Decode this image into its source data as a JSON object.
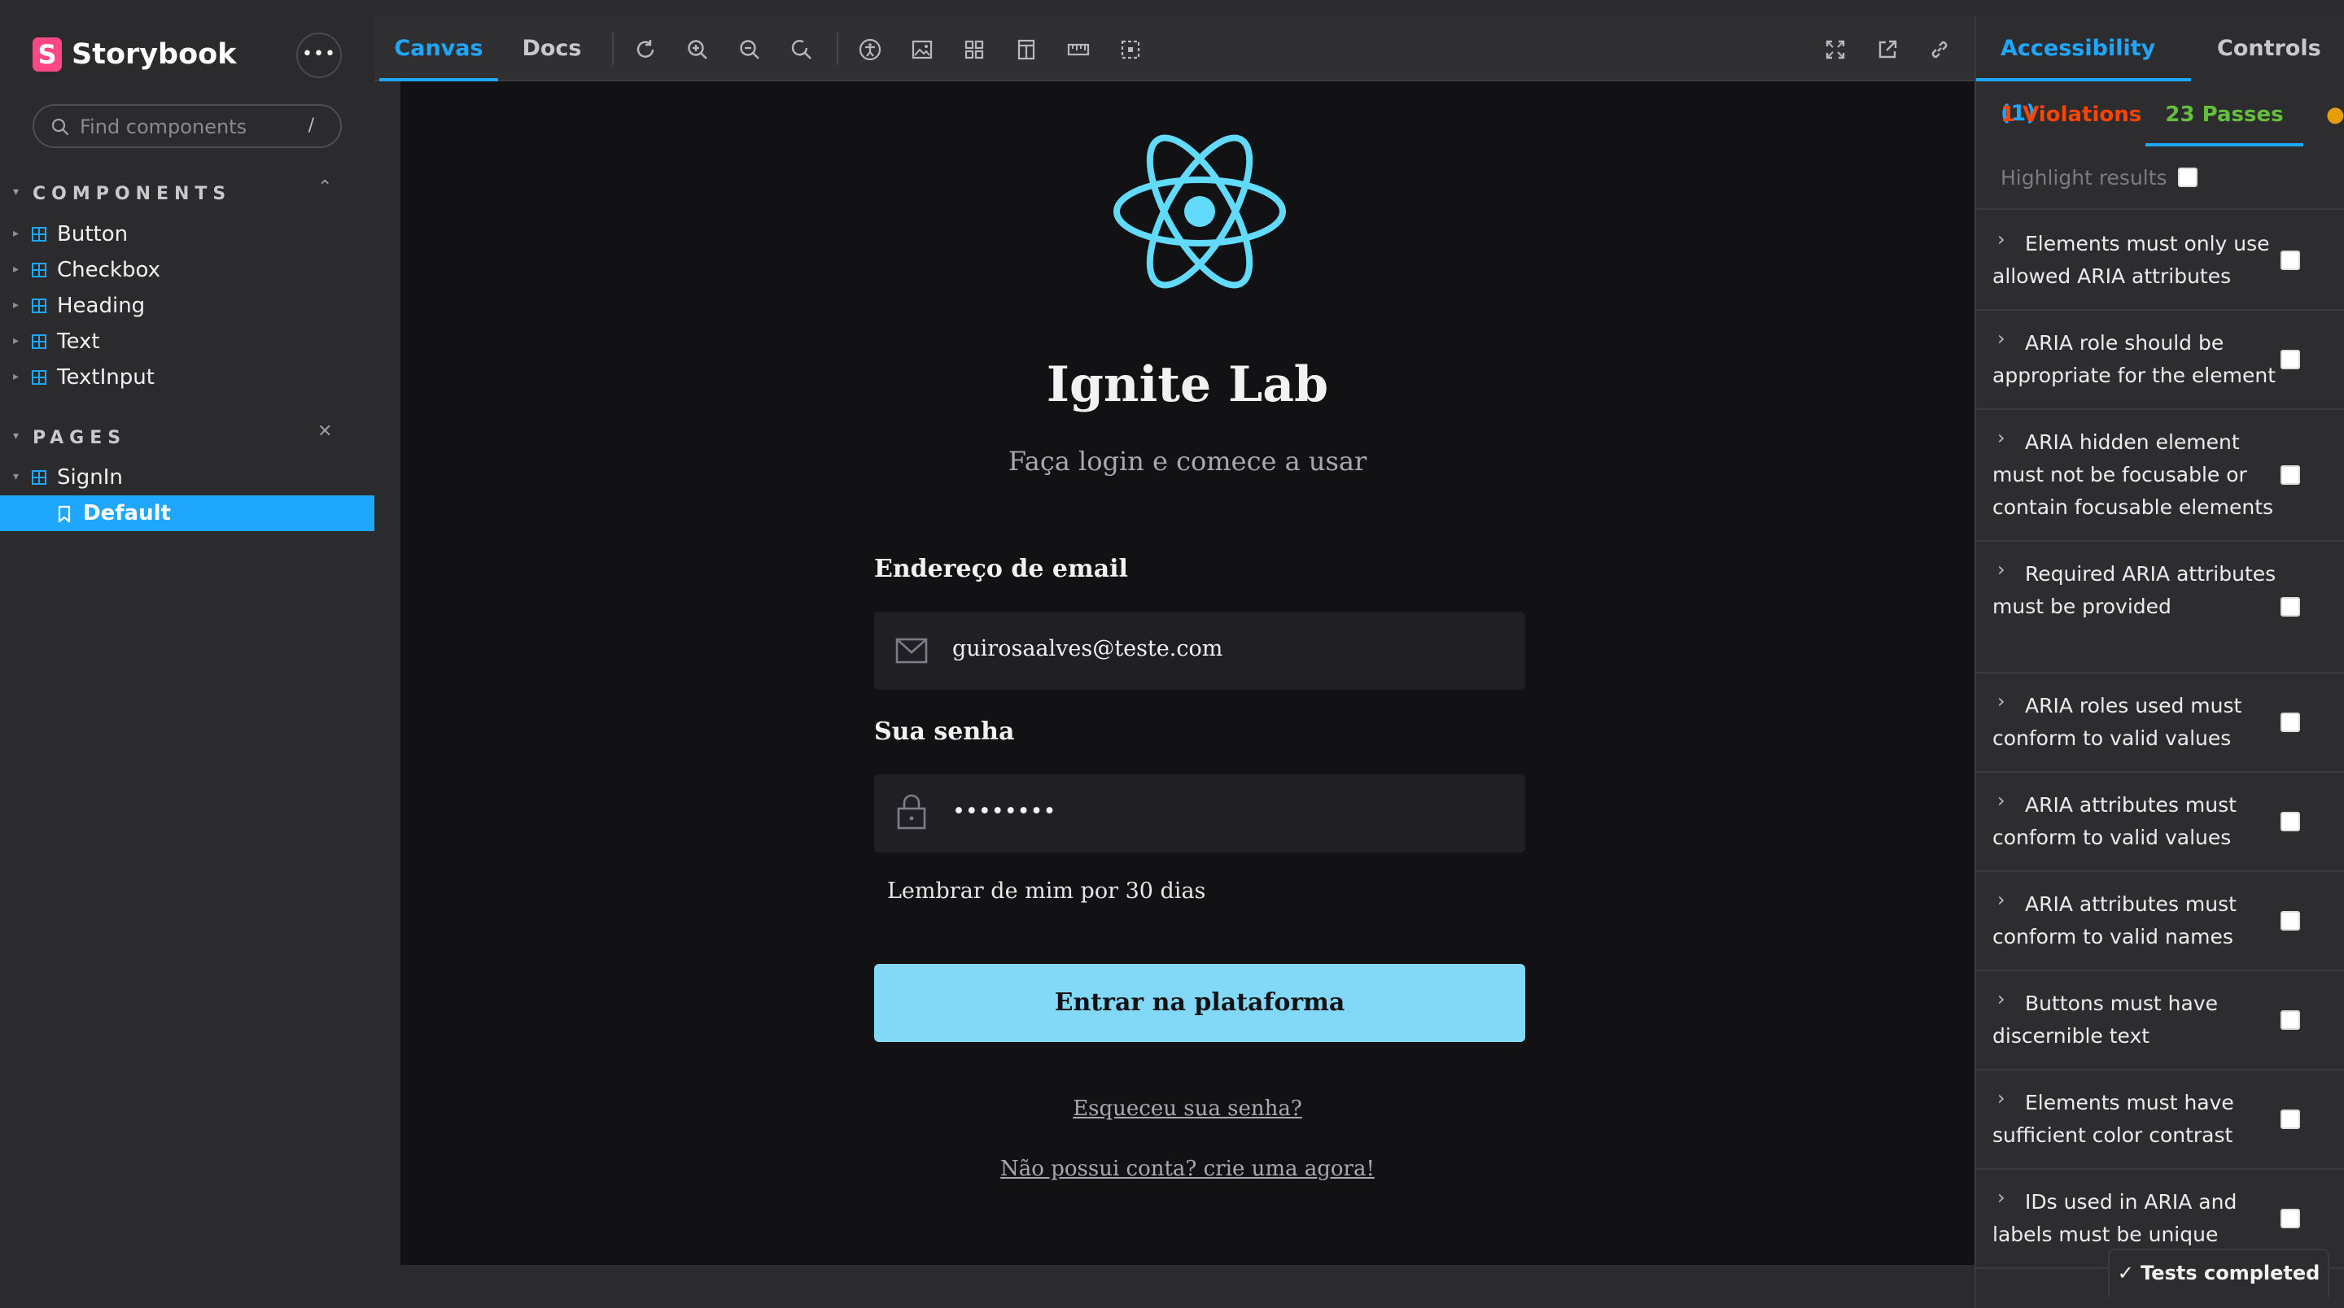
{
  "app": {
    "name": "Storybook",
    "menu_label": "•••"
  },
  "search": {
    "placeholder": "Find components",
    "shortcut": "/"
  },
  "sidebar": {
    "components_label": "COMPONENTS",
    "components": [
      {
        "label": "Button"
      },
      {
        "label": "Checkbox"
      },
      {
        "label": "Heading"
      },
      {
        "label": "Text"
      },
      {
        "label": "TextInput"
      }
    ],
    "pages_label": "PAGES",
    "pages": [
      {
        "label": "SignIn"
      }
    ],
    "stories": [
      {
        "label": "Default",
        "selected": true
      }
    ]
  },
  "toolbar": {
    "tabs": [
      {
        "label": "Canvas",
        "active": true
      },
      {
        "label": "Docs",
        "active": false
      }
    ],
    "tools": [
      "reload-icon",
      "zoom-in-icon",
      "zoom-out-icon",
      "zoom-reset-icon",
      "accessibility-icon",
      "background-icon",
      "grid-icon",
      "viewport-icon",
      "measure-icon",
      "outline-icon"
    ],
    "right_tools": [
      "fullscreen-icon",
      "open-new-tab-icon",
      "copy-link-icon"
    ]
  },
  "preview": {
    "title": "Ignite Lab",
    "subtitle": "Faça login e comece a usar",
    "email_label": "Endereço de email",
    "email_value": "guirosaalves@teste.com",
    "password_label": "Sua senha",
    "password_value": "••••••••",
    "remember_label": "Lembrar de mim por 30 dias",
    "submit_label": "Entrar na plataforma",
    "forgot_link": "Esqueceu sua senha?",
    "signup_link": "Não possui conta? crie uma agora!",
    "logo_color": "#61dafb"
  },
  "panel": {
    "tabs": [
      {
        "label": "Accessibility (1)",
        "active": true
      },
      {
        "label": "Controls",
        "active": false
      }
    ],
    "subtabs": {
      "violations": "1 Violations",
      "passes": "23 Passes"
    },
    "highlight_label": "Highlight results",
    "rules": [
      {
        "text": "Elements must only use allowed ARIA attributes"
      },
      {
        "text": "ARIA role should be appropriate for the element"
      },
      {
        "text": "ARIA hidden element must not be focusable or contain focusable elements"
      },
      {
        "text": "Required ARIA attributes must be provided"
      },
      {
        "text": "ARIA roles used must conform to valid values"
      },
      {
        "text": "ARIA attributes must conform to valid values"
      },
      {
        "text": "ARIA attributes must conform to valid names"
      },
      {
        "text": "Buttons must have discernible text"
      },
      {
        "text": "Elements must have sufficient color contrast"
      },
      {
        "text": "IDs used in ARIA and labels must be unique"
      }
    ],
    "status": "Tests completed"
  },
  "colors": {
    "accent": "#1ea7fd",
    "violation": "#ff4400",
    "pass": "#66bf3c",
    "incomplete": "#e69d00",
    "button": "#81d8f7"
  }
}
